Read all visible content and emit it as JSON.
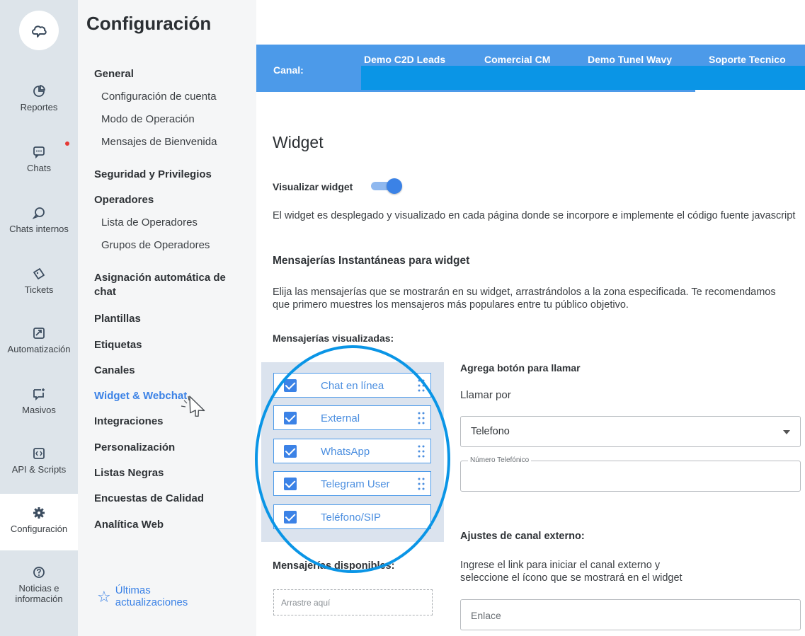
{
  "rail": {
    "items": [
      {
        "label": "Reportes",
        "icon": "pie-chart-icon"
      },
      {
        "label": "Chats",
        "icon": "chat-icon"
      },
      {
        "label": "Chats internos",
        "icon": "internal-chat-icon"
      },
      {
        "label": "Tickets",
        "icon": "ticket-icon"
      },
      {
        "label": "Automatización",
        "icon": "automation-icon"
      },
      {
        "label": "Masivos",
        "icon": "bulk-message-icon"
      },
      {
        "label": "API & Scripts",
        "icon": "code-icon"
      },
      {
        "label": "Configuración",
        "icon": "gear-icon"
      },
      {
        "label": "Noticias e información",
        "icon": "help-icon"
      }
    ]
  },
  "menu": {
    "title": "Configuración",
    "general": "General",
    "account": "Configuración de cuenta",
    "mode": "Modo de Operación",
    "welcome": "Mensajes de Bienvenida",
    "security": "Seguridad y Privilegios",
    "operators": "Operadores",
    "operators_list": "Lista de Operadores",
    "operators_groups": "Grupos de Operadores",
    "auto_assign": "Asignación automática de chat",
    "templates": "Plantillas",
    "tags": "Etiquetas",
    "channels": "Canales",
    "widget": "Widget & Webchat",
    "integrations": "Integraciones",
    "custom": "Personalización",
    "blacklists": "Listas Negras",
    "surveys": "Encuestas de Calidad",
    "analytics": "Analítica Web",
    "updates": "Últimas actualizaciones"
  },
  "channel_bar": {
    "label": "Canal:",
    "tabs": [
      "Demo C2D Leads",
      "Comercial CM",
      "Demo Tunel Wavy",
      "Soporte Tecnico"
    ]
  },
  "main": {
    "title": "Widget",
    "show_widget": "Visualizar widget",
    "show_widget_desc": "El widget es desplegado y visualizado en cada página donde se incorpore e implemente el código fuente javascript",
    "im_heading": "Mensajerías Instantáneas para widget",
    "im_desc": "Elija las mensajerías que se mostrarán en su widget, arrastrándolos a la zona especificada. Te recomendamos que primero muestres los mensajeros más populares entre tu público objetivo.",
    "visible_label": "Mensajerías visualizadas:",
    "messengers": [
      "Chat en línea",
      "External",
      "WhatsApp",
      "Telegram User",
      "Teléfono/SIP"
    ],
    "available_label": "Mensajerías disponibles:",
    "drop_here": "Arrastre aquí",
    "call_heading": "Agrega botón para llamar",
    "call_by": "Llamar por",
    "call_select": "Telefono",
    "phone_legend": "Número Telefónico",
    "external_heading": "Ajustes de canal externo:",
    "external_desc": "Ingrese el link para iniciar el canal externo y seleccione el ícono que se mostrará en el widget",
    "link_placeholder": "Enlace"
  },
  "colors": {
    "accent": "#3b82e6",
    "channel_bar": "#4c9ae9",
    "highlight_circle": "#0a95e6"
  }
}
